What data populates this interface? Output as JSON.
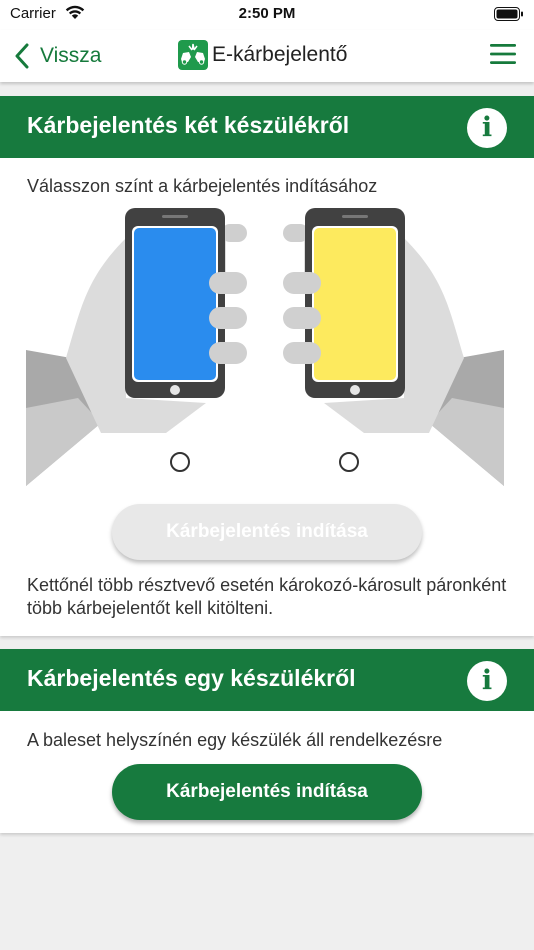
{
  "status_bar": {
    "carrier": "Carrier",
    "time": "2:50 PM"
  },
  "nav": {
    "back_label": "Vissza",
    "app_title": "E-kárbejelentő"
  },
  "two_device_card": {
    "title": "Kárbejelentés két készülékről",
    "info_label": "i",
    "subtitle": "Válasszon színt a kárbejelentés indításához",
    "start_button": "Kárbejelentés indítása",
    "note": "Kettőnél több résztvevő esetén károkozó-károsult páronként több kárbejelentőt kell kitölteni."
  },
  "one_device_card": {
    "title": "Kárbejelentés egy készülékről",
    "info_label": "i",
    "subtitle": "A baleset helyszínén egy készülék áll rendelkezésre",
    "start_button": "Kárbejelentés indítása"
  },
  "colors": {
    "brand_green": "#177a3e",
    "phone_blue": "#2a8cee",
    "phone_yellow": "#fdea5e",
    "disabled_button": "#e8e8e8"
  },
  "icons": [
    "wifi-icon",
    "battery-icon",
    "back-chevron-icon",
    "logo-icon",
    "menu-icon",
    "info-icon"
  ]
}
